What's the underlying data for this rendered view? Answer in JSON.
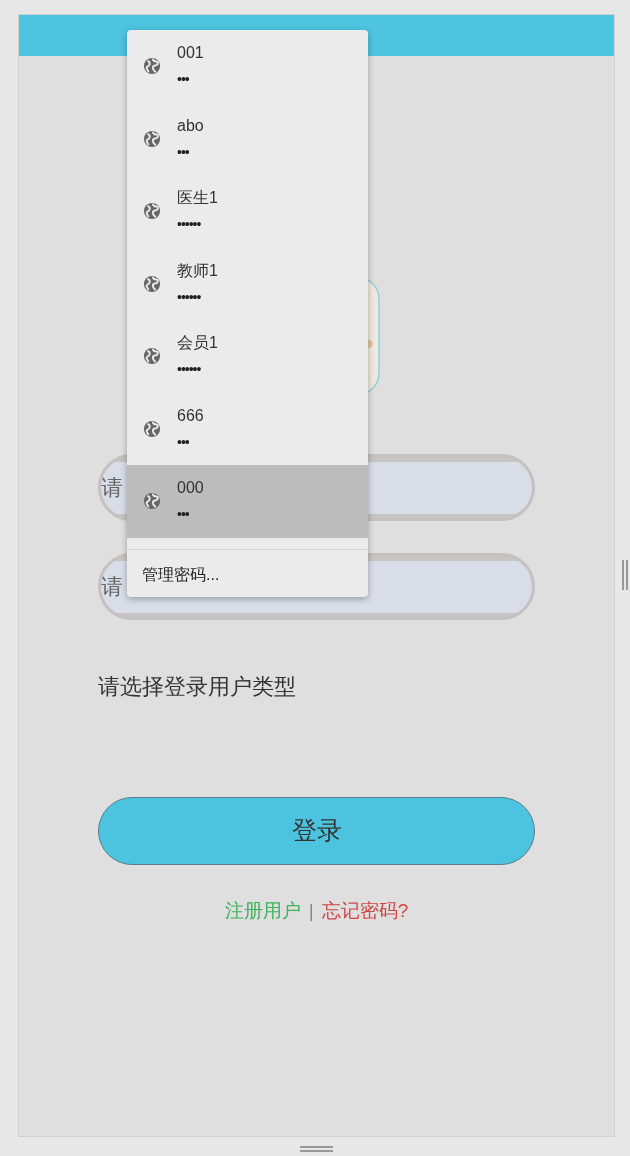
{
  "login_form": {
    "fields": [
      {
        "placeholder": "请"
      },
      {
        "placeholder": "请"
      }
    ],
    "user_type_label": "请选择登录用户类型",
    "login_button": "登录",
    "links": [
      {
        "kind": "register",
        "label": "注册用户"
      },
      {
        "kind": "separator",
        "label": "|"
      },
      {
        "kind": "forgot",
        "label": "忘记密码?"
      }
    ]
  },
  "password_dropdown": {
    "items": [
      {
        "username": "001",
        "password": "•••",
        "selected": false
      },
      {
        "username": "abo",
        "password": "•••",
        "selected": false
      },
      {
        "username": "医生1",
        "password": "••••••",
        "selected": false
      },
      {
        "username": "教师1",
        "password": "••••••",
        "selected": false
      },
      {
        "username": "会员1",
        "password": "••••••",
        "selected": false
      },
      {
        "username": "666",
        "password": "•••",
        "selected": false
      },
      {
        "username": "000",
        "password": "•••",
        "selected": true
      }
    ],
    "manage_label": "管理密码..."
  }
}
